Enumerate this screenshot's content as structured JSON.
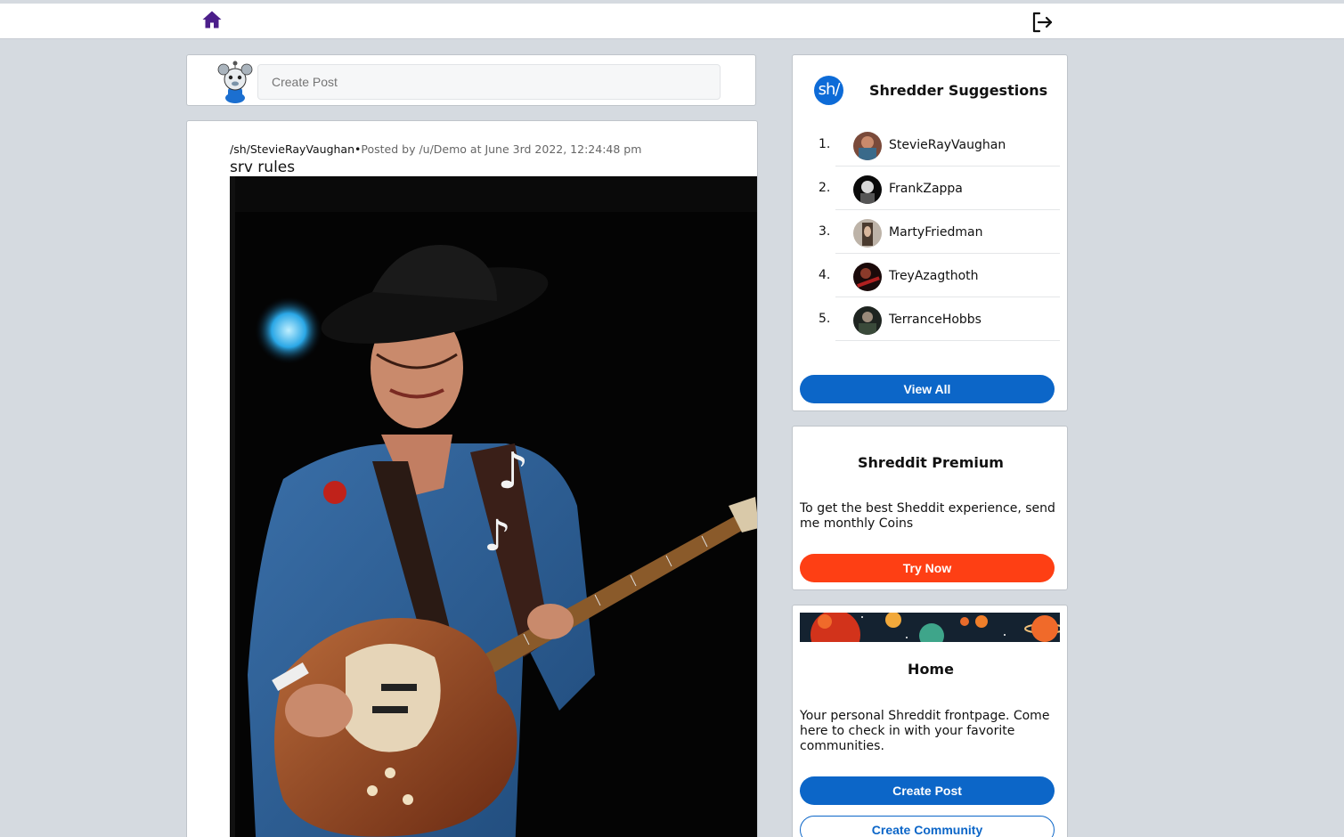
{
  "nav": {
    "home_icon": "home-icon",
    "logout_icon": "logout-icon"
  },
  "create_post_bar": {
    "placeholder": "Create Post"
  },
  "post": {
    "subreddit": "/sh/StevieRayVaughan",
    "separator": "•",
    "posted_by": "Posted by /u/Demo at June 3rd 2022, 12:24:48 pm",
    "title": "srv rules"
  },
  "suggestions": {
    "logo_text": "sh/",
    "title": "Shredder Suggestions",
    "items": [
      {
        "rank": "1.",
        "name": "StevieRayVaughan"
      },
      {
        "rank": "2.",
        "name": "FrankZappa"
      },
      {
        "rank": "3.",
        "name": "MartyFriedman"
      },
      {
        "rank": "4.",
        "name": "TreyAzagthoth"
      },
      {
        "rank": "5.",
        "name": "TerranceHobbs"
      }
    ],
    "view_all_label": "View All"
  },
  "premium": {
    "title": "Shreddit Premium",
    "description": "To get the best Sheddit experience, send me monthly Coins",
    "button_label": "Try Now"
  },
  "home_card": {
    "title": "Home",
    "description": "Your personal Shreddit frontpage. Come here to check in with your favorite communities.",
    "create_post_label": "Create Post",
    "create_community_label": "Create Community"
  },
  "colors": {
    "page_bg": "#d5dae0",
    "primary_blue": "#0c66c8",
    "premium_orange": "#fe3f14",
    "home_icon": "#4b1e8a"
  }
}
